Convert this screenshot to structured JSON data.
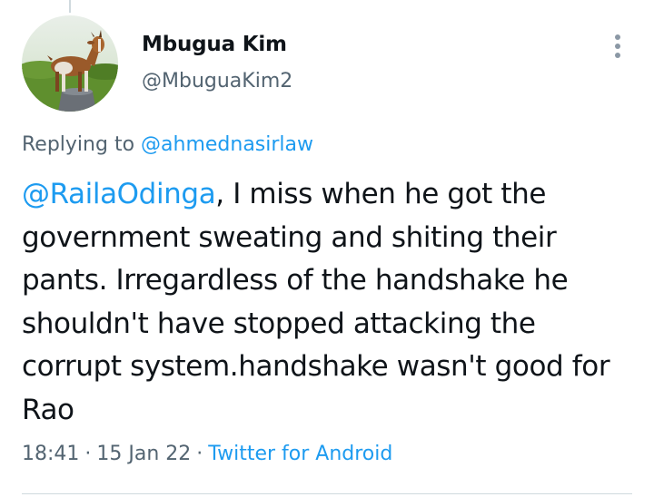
{
  "author": {
    "display_name": "Mbugua Kim",
    "handle": "@MbuguaKim2",
    "avatar_icon": "goat-avatar-icon"
  },
  "reply_context": {
    "prefix": "Replying to",
    "mention": "@ahmednasirlaw"
  },
  "tweet": {
    "mention": "@RailaOdinga",
    "text": ", I miss when he got the government sweating and shiting their pants. Irregardless of the handshake he shouldn't have stopped attacking the corrupt system.handshake wasn't good for Rao"
  },
  "meta": {
    "time": "18:41",
    "separator": "·",
    "date": "15 Jan 22",
    "source": "Twitter for Android"
  },
  "menu": {
    "icon": "more-options-icon"
  },
  "colors": {
    "link": "#1d9bf0",
    "secondary_text": "#536471",
    "primary_text": "#0f1419",
    "divider": "#cfd9de"
  }
}
